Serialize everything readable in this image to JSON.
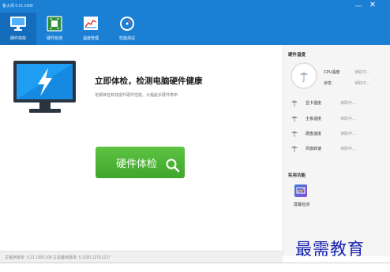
{
  "window": {
    "title": "鲁大师 5.21.1300",
    "minimize_glyph": "—",
    "close_glyph": "✕"
  },
  "nav": {
    "tabs": [
      {
        "label": "硬件体检",
        "icon": "monitor-check-icon",
        "active": true
      },
      {
        "label": "硬件检测",
        "icon": "chip-icon",
        "active": false
      },
      {
        "label": "温度管理",
        "icon": "temperature-chart-icon",
        "active": false
      },
      {
        "label": "性能测试",
        "icon": "speedometer-icon",
        "active": false
      }
    ]
  },
  "main": {
    "headline": "立即体检，检测电脑硬件健康",
    "subline": "定期体检有效提升硬件性能，大幅延长硬件寿命",
    "check_button": "硬件体检"
  },
  "side": {
    "temp_title": "硬件温度",
    "cpu_label": "CPU温度",
    "status_label": "状态",
    "reading": "读取中...",
    "sensors": [
      {
        "label": "显卡温度",
        "value": "读取中..."
      },
      {
        "label": "主板温度",
        "value": "读取中..."
      },
      {
        "label": "硬盘温度",
        "value": "读取中..."
      },
      {
        "label": "风扇转速",
        "value": "读取中..."
      }
    ],
    "tools_title": "实用功能",
    "tools": [
      {
        "label": "屏幕检测",
        "icon": "screen-test-icon"
      }
    ]
  },
  "status": {
    "text": "主程序版本: 5.21.1300.108  主设备库版本: 5.1020.1270.1127"
  },
  "watermark": "最需教育",
  "colors": {
    "header_blue": "#1b7fd4",
    "active_tab": "#156cbb",
    "button_green": "#4cb436",
    "watermark_blue": "#1a24b0"
  }
}
